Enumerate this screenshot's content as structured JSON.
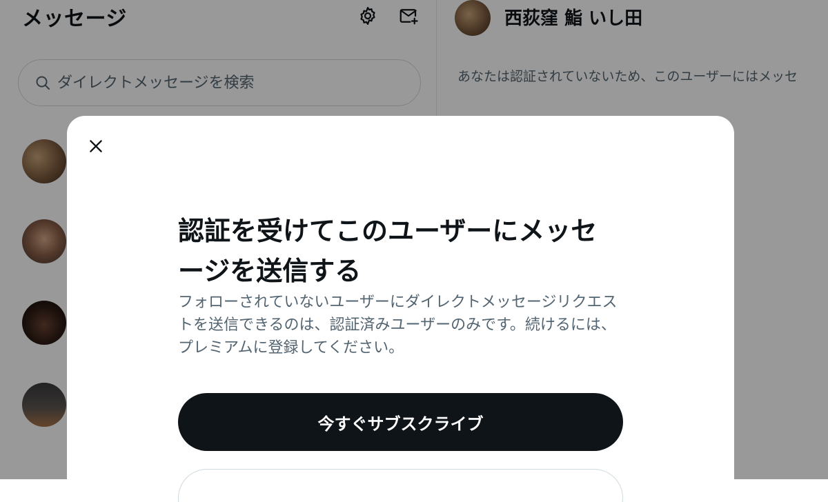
{
  "messages_pane": {
    "title": "メッセージ",
    "settings_icon": "gear-icon",
    "new_message_icon": "new-message-icon",
    "search": {
      "icon": "search-icon",
      "placeholder": "ダイレクトメッセージを検索"
    },
    "conversations": [
      {
        "avatar": "avatar"
      },
      {
        "avatar": "avatar"
      },
      {
        "avatar": "avatar"
      },
      {
        "avatar": "avatar"
      }
    ]
  },
  "conversation_pane": {
    "name": "西荻窪 鮨 いし田",
    "notice": "あなたは認証されていないため、このユーザーにはメッセ"
  },
  "modal": {
    "close_icon": "close-icon",
    "title": "認証を受けてこのユーザーにメッセージを送信する",
    "body": "フォローされていないユーザーにダイレクトメッセージリクエストを送信できるのは、認証済みユーザーのみです。続けるには、プレミアムに登録してください。",
    "primary_button": "今すぐサブスクライブ"
  },
  "colors": {
    "text_primary": "#0f1419",
    "text_secondary": "#536471",
    "border": "#cfd9de",
    "primary_button_bg": "#0f1419",
    "primary_button_text": "#ffffff",
    "backdrop": "rgba(0,0,0,0.4)"
  }
}
